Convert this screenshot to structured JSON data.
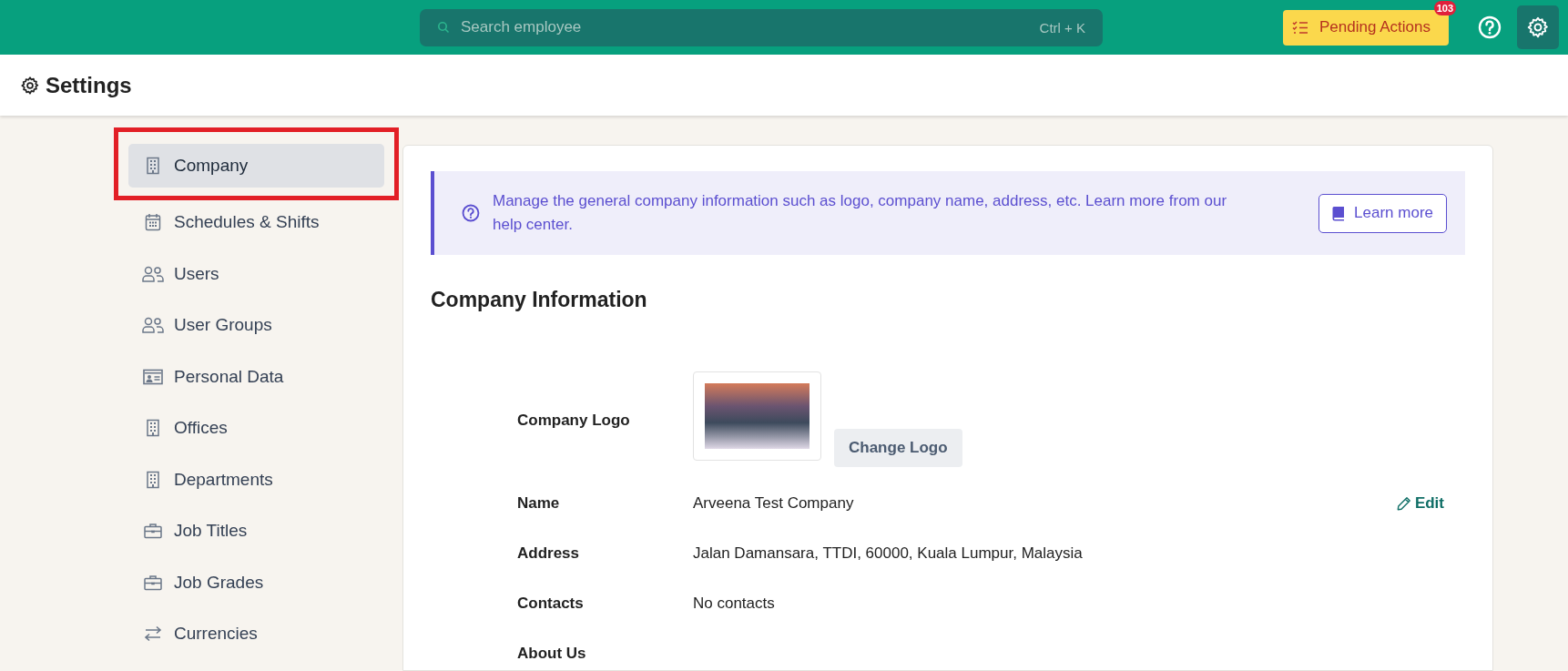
{
  "top_bar": {
    "search": {
      "placeholder": "Search employee",
      "shortcut": "Ctrl + K"
    },
    "pending_actions": {
      "label": "Pending Actions",
      "badge": "103"
    }
  },
  "header": {
    "title": "Settings"
  },
  "sidebar": {
    "items": [
      {
        "label": "Company",
        "selected": true,
        "highlighted": true
      },
      {
        "label": "Schedules & Shifts",
        "selected": false,
        "highlighted": false
      },
      {
        "label": "Users",
        "selected": false,
        "highlighted": false
      },
      {
        "label": "User Groups",
        "selected": false,
        "highlighted": false
      },
      {
        "label": "Personal Data",
        "selected": false,
        "highlighted": false
      },
      {
        "label": "Offices",
        "selected": false,
        "highlighted": false
      },
      {
        "label": "Departments",
        "selected": false,
        "highlighted": false
      },
      {
        "label": "Job Titles",
        "selected": false,
        "highlighted": false
      },
      {
        "label": "Job Grades",
        "selected": false,
        "highlighted": false
      },
      {
        "label": "Currencies",
        "selected": false,
        "highlighted": false
      }
    ]
  },
  "info_banner": {
    "text": "Manage the general company information such as logo, company name, address, etc. Learn more from our help center.",
    "button": "Learn more"
  },
  "company_information": {
    "title": "Company Information",
    "rows": [
      {
        "kind": "logo",
        "label": "Company Logo",
        "button": "Change Logo"
      },
      {
        "kind": "text",
        "label": "Name",
        "value": "Arveena Test Company",
        "action": "Edit"
      },
      {
        "kind": "text",
        "label": "Address",
        "value": "Jalan Damansara, TTDI, 60000, Kuala Lumpur, Malaysia"
      },
      {
        "kind": "text",
        "label": "Contacts",
        "value": "No contacts"
      },
      {
        "kind": "text",
        "label": "About Us"
      }
    ]
  }
}
